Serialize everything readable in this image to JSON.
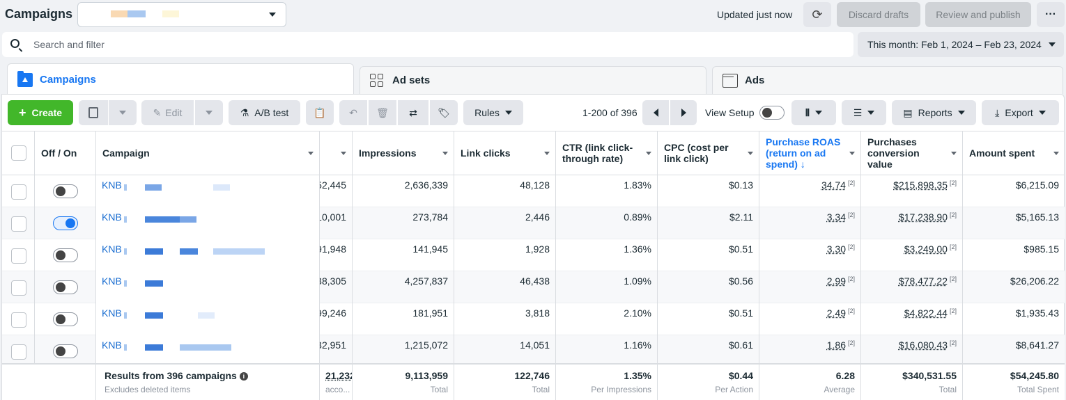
{
  "header": {
    "title": "Campaigns",
    "updated": "Updated just now",
    "discard": "Discard drafts",
    "review": "Review and publish"
  },
  "search": {
    "placeholder": "Search and filter"
  },
  "date_range": "This month: Feb 1, 2024 – Feb 23, 2024",
  "tabs": {
    "campaigns": "Campaigns",
    "adsets": "Ad sets",
    "ads": "Ads"
  },
  "toolbar": {
    "create": "Create",
    "edit": "Edit",
    "ab_test": "A/B test",
    "rules": "Rules",
    "pager": "1-200 of 396",
    "view_setup": "View Setup",
    "reports": "Reports",
    "export": "Export"
  },
  "columns": {
    "off_on": "Off / On",
    "campaign": "Campaign",
    "impressions": "Impressions",
    "link_clicks": "Link clicks",
    "ctr": "CTR (link click-through rate)",
    "cpc": "CPC (cost per link click)",
    "roas": "Purchase ROAS (return on ad spend) ↓",
    "conv_value": "Purchases conversion value",
    "amount": "Amount spent"
  },
  "rows": [
    {
      "name": "KNB",
      "on": false,
      "hidden": "52,445",
      "impressions": "2,636,339",
      "clicks": "48,128",
      "ctr": "1.83%",
      "cpc": "$0.13",
      "roas": "34.74",
      "value": "$215,898.35",
      "spent": "$6,215.09"
    },
    {
      "name": "KNB",
      "on": true,
      "hidden": "10,001",
      "impressions": "273,784",
      "clicks": "2,446",
      "ctr": "0.89%",
      "cpc": "$2.11",
      "roas": "3.34",
      "value": "$17,238.90",
      "spent": "$5,165.13"
    },
    {
      "name": "KNB",
      "on": false,
      "hidden": "91,948",
      "impressions": "141,945",
      "clicks": "1,928",
      "ctr": "1.36%",
      "cpc": "$0.51",
      "roas": "3.30",
      "value": "$3,249.00",
      "spent": "$985.15"
    },
    {
      "name": "KNB",
      "on": false,
      "hidden": "38,305",
      "impressions": "4,257,837",
      "clicks": "46,438",
      "ctr": "1.09%",
      "cpc": "$0.56",
      "roas": "2.99",
      "value": "$78,477.22",
      "spent": "$26,206.22"
    },
    {
      "name": "KNB",
      "on": false,
      "hidden": "99,246",
      "impressions": "181,951",
      "clicks": "3,818",
      "ctr": "2.10%",
      "cpc": "$0.51",
      "roas": "2.49",
      "value": "$4,822.44",
      "spent": "$1,935.43"
    },
    {
      "name": "KNB",
      "on": false,
      "hidden": "32,951",
      "impressions": "1,215,072",
      "clicks": "14,051",
      "ctr": "1.16%",
      "cpc": "$0.61",
      "roas": "1.86",
      "value": "$16,080.43",
      "spent": "$8,641.27"
    }
  ],
  "sup_marker": "[2]",
  "footer": {
    "results": "Results from 396 campaigns",
    "excludes": "Excludes deleted items",
    "hidden_total": "21,232",
    "hidden_label": "acco...",
    "impressions": "9,113,959",
    "impressions_label": "Total",
    "clicks": "122,746",
    "clicks_label": "Total",
    "ctr": "1.35%",
    "ctr_label": "Per Impressions",
    "cpc": "$0.44",
    "cpc_label": "Per Action",
    "roas": "6.28",
    "roas_label": "Average",
    "value": "$340,531.55",
    "value_label": "Total",
    "spent": "$54,245.80",
    "spent_label": "Total Spent"
  },
  "colors": {
    "accent": "#1877f2",
    "create": "#42b72a",
    "link": "#1d6fd1"
  },
  "icons": [
    "search-icon",
    "refresh-icon",
    "more-icon",
    "folder-icon",
    "grid-icon",
    "ad-icon",
    "plus-icon",
    "duplicate-icon",
    "pencil-icon",
    "flask-icon",
    "clipboard-icon",
    "undo-icon",
    "trash-icon",
    "swap-icon",
    "tag-icon",
    "columns-icon",
    "breakdown-icon",
    "reports-icon",
    "export-icon",
    "info-icon"
  ]
}
